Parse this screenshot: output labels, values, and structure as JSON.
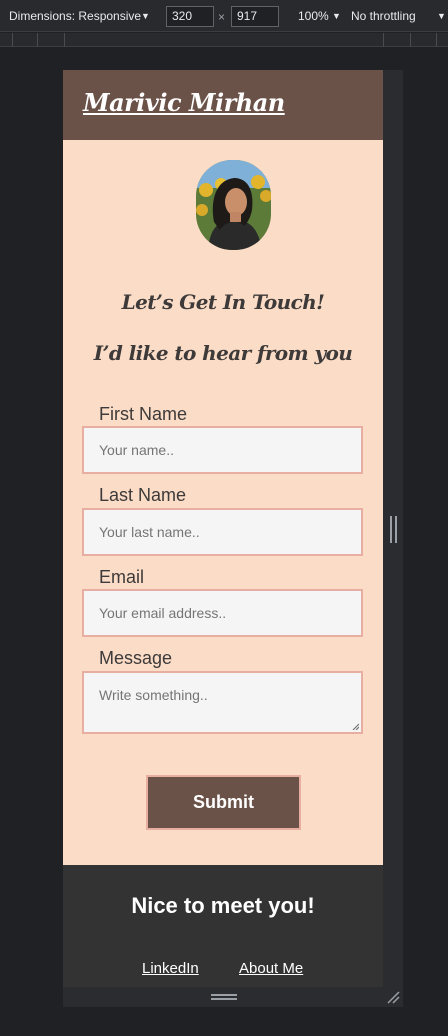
{
  "devtools": {
    "dimensions_label": "Dimensions: Responsive",
    "width_value": "320",
    "times": "×",
    "height_value": "917",
    "zoom_label": "100%",
    "throttling_label": "No throttling"
  },
  "site": {
    "title": "Marivic Mirhan",
    "headline": "Let’s Get In Touch!",
    "subheadline": "I’d like to hear from you"
  },
  "form": {
    "fields": [
      {
        "label": "First Name",
        "placeholder": "Your name.."
      },
      {
        "label": "Last Name",
        "placeholder": "Your last name.."
      },
      {
        "label": "Email",
        "placeholder": "Your email address.."
      },
      {
        "label": "Message",
        "placeholder": "Write something.."
      }
    ],
    "submit_label": "Submit"
  },
  "footer": {
    "title": "Nice to meet you!",
    "links": [
      "LinkedIn",
      "About Me"
    ]
  },
  "colors": {
    "header_bg": "#6b5248",
    "page_bg": "#fbdcc7",
    "field_border": "#e7aea1",
    "footer_bg": "#333333"
  },
  "icons": [
    "dropdown-caret-icon",
    "profile-photo",
    "side-resize-handle-icon",
    "bottom-resize-handle-icon",
    "corner-resize-handle-icon"
  ]
}
